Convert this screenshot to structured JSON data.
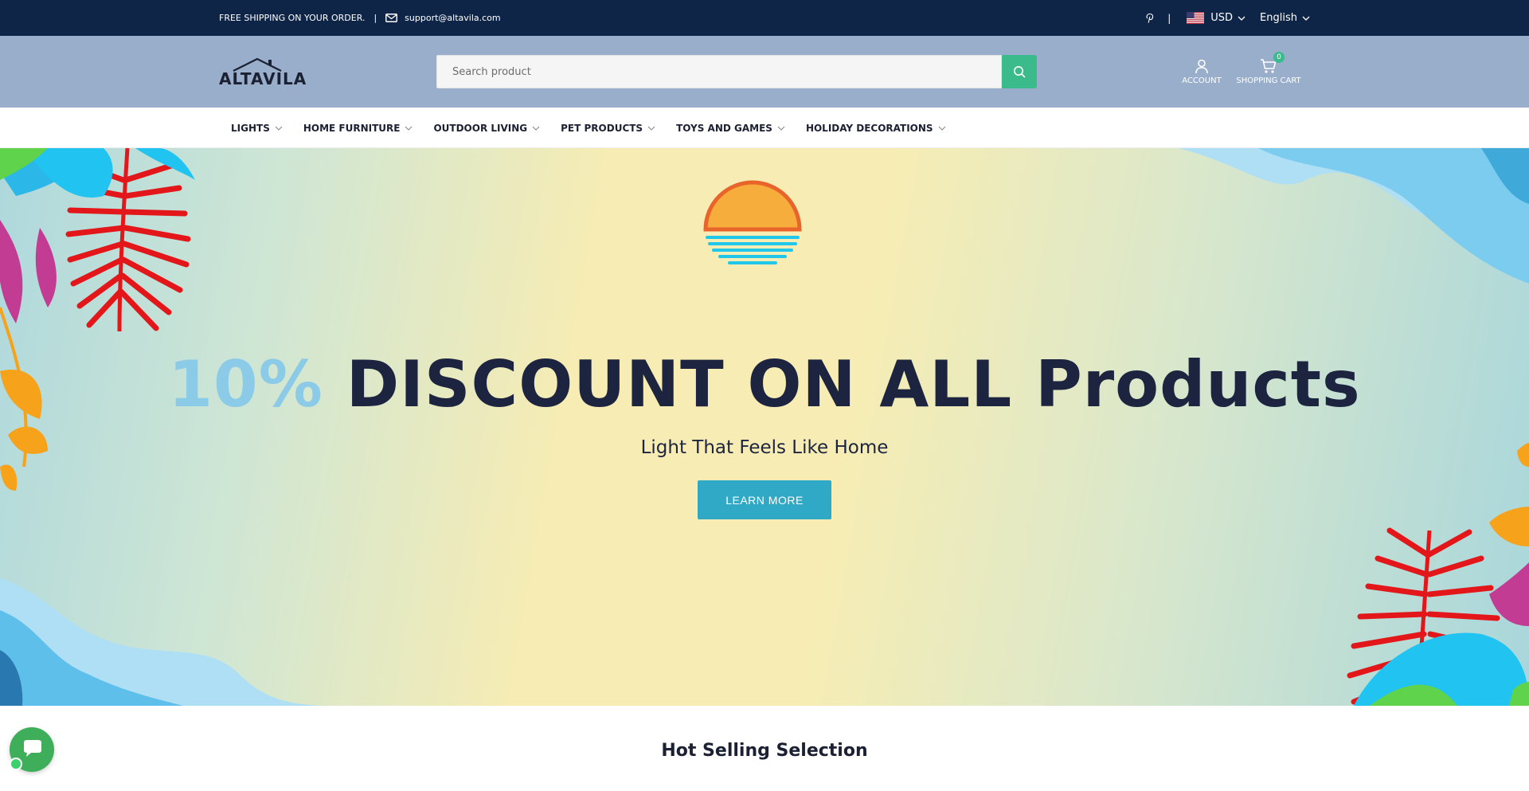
{
  "topbar": {
    "shipping_text": "FREE SHIPPING ON YOUR ORDER.",
    "separator": "|",
    "email": "support@altavila.com",
    "divider": "|",
    "currency": "USD",
    "language": "English"
  },
  "header": {
    "logo_text": "ALTAVILA",
    "search_placeholder": "Search product",
    "account_label": "ACCOUNT",
    "cart_label": "SHOPPING CART",
    "cart_count": "0"
  },
  "nav": {
    "items": [
      {
        "label": "LIGHTS"
      },
      {
        "label": "HOME FURNITURE"
      },
      {
        "label": "OUTDOOR LIVING"
      },
      {
        "label": "PET PRODUCTS"
      },
      {
        "label": "TOYS AND GAMES"
      },
      {
        "label": "HOLIDAY DECORATIONS"
      }
    ]
  },
  "hero": {
    "discount": "10%",
    "headline_rest": "DISCOUNT ON ALL Products",
    "subline": "Light That Feels Like Home",
    "cta": "LEARN MORE"
  },
  "section": {
    "title": "Hot Selling Selection"
  },
  "colors": {
    "topbar_bg": "#0f2548",
    "header_bg": "#99aecb",
    "accent_green": "#3bba8b",
    "cta_blue": "#2fa9c6",
    "discount_blue": "#8ccbe7",
    "headline_navy": "#1d2440"
  }
}
